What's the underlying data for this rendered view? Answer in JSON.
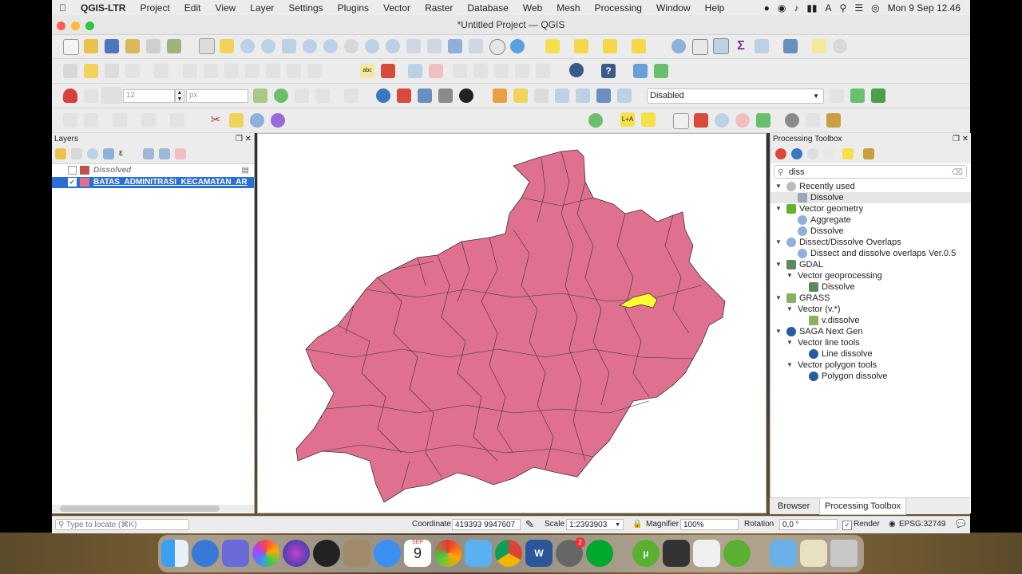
{
  "menubar": {
    "app": "QGIS-LTR",
    "items": [
      "Project",
      "Edit",
      "View",
      "Layer",
      "Settings",
      "Plugins",
      "Vector",
      "Raster",
      "Database",
      "Web",
      "Mesh",
      "Processing",
      "Window",
      "Help"
    ],
    "clock": "Mon 9 Sep  12.46"
  },
  "window": {
    "title": "*Untitled Project — QGIS"
  },
  "toolbar": {
    "snap_tolerance": "12",
    "snap_units": "px",
    "snapping_mode": "Disabled"
  },
  "layers_panel": {
    "title": "Layers",
    "layers": [
      {
        "name": "Dissolved",
        "checked": false,
        "color": "#c0504d"
      },
      {
        "name": "BATAS_ADMINITRASI_KECAMATAN_AR",
        "checked": true,
        "color": "#e07090"
      }
    ]
  },
  "toolbox": {
    "title": "Processing Toolbox",
    "search_value": "diss",
    "tree": [
      {
        "label": "Recently used",
        "level": 0,
        "icon": "clock-icon"
      },
      {
        "label": "Dissolve",
        "level": 1,
        "icon": "dissolve-icon",
        "selected": true
      },
      {
        "label": "Vector geometry",
        "level": 0,
        "icon": "qgis-icon"
      },
      {
        "label": "Aggregate",
        "level": 1,
        "icon": "gear-icon"
      },
      {
        "label": "Dissolve",
        "level": 1,
        "icon": "gear-icon"
      },
      {
        "label": "Dissect/Dissolve Overlaps",
        "level": 0,
        "icon": "gear-icon"
      },
      {
        "label": "Dissect and dissolve overlaps Ver.0.5",
        "level": 1,
        "icon": "gear-icon"
      },
      {
        "label": "GDAL",
        "level": 0,
        "icon": "gdal-icon"
      },
      {
        "label": "Vector geoprocessing",
        "level": 1,
        "icon": ""
      },
      {
        "label": "Dissolve",
        "level": 2,
        "icon": "gdal-icon"
      },
      {
        "label": "GRASS",
        "level": 0,
        "icon": "grass-icon"
      },
      {
        "label": "Vector (v.*)",
        "level": 1,
        "icon": ""
      },
      {
        "label": "v.dissolve",
        "level": 2,
        "icon": "grass-icon"
      },
      {
        "label": "SAGA Next Gen",
        "level": 0,
        "icon": "saga-icon"
      },
      {
        "label": "Vector line tools",
        "level": 1,
        "icon": ""
      },
      {
        "label": "Line dissolve",
        "level": 2,
        "icon": "saga-icon"
      },
      {
        "label": "Vector polygon tools",
        "level": 1,
        "icon": ""
      },
      {
        "label": "Polygon dissolve",
        "level": 2,
        "icon": "saga-icon"
      }
    ],
    "tabs": [
      "Browser",
      "Processing Toolbox"
    ],
    "active_tab": "Processing Toolbox"
  },
  "statusbar": {
    "locate_placeholder": "Type to locate (⌘K)",
    "coordinate_label": "Coordinate",
    "coordinate": "419393  9947607",
    "scale_label": "Scale",
    "scale": "1:2393903",
    "magnifier_label": "Magnifier",
    "magnifier": "100%",
    "rotation_label": "Rotation",
    "rotation": "0,0 °",
    "render_label": "Render",
    "crs": "EPSG:32749"
  },
  "map": {
    "polygon_fill": "#e07090",
    "highlight_fill": "#ffff33"
  },
  "dock": {
    "calendar_month": "SEP",
    "calendar_day": "9",
    "badge": "2"
  }
}
